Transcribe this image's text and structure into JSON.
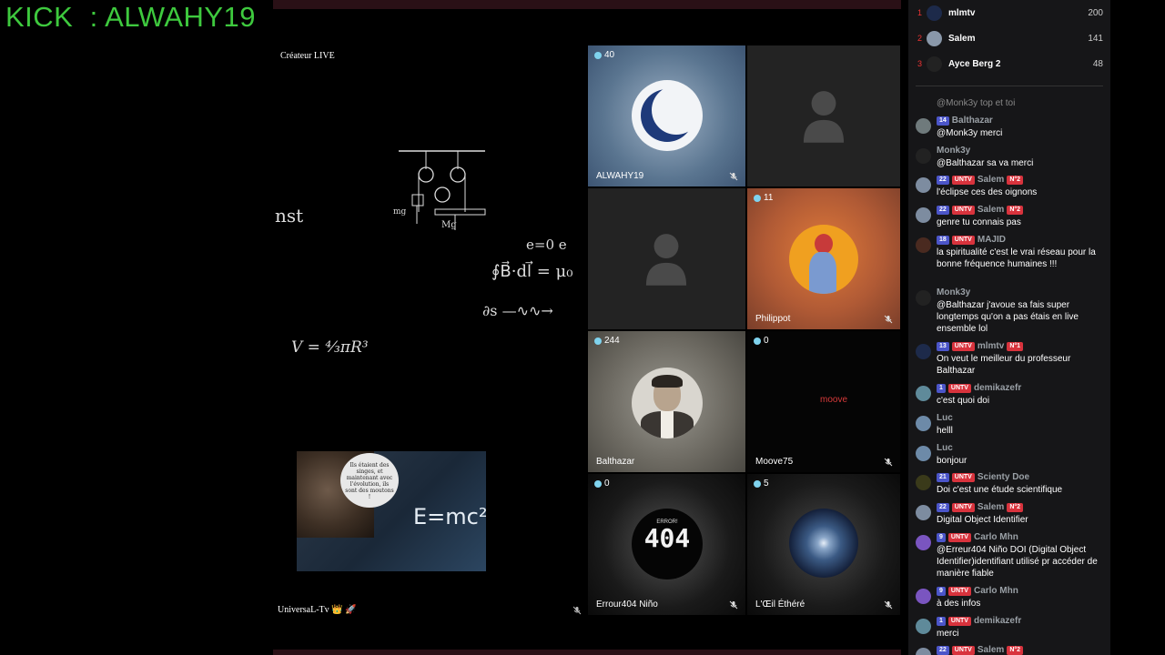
{
  "overlay": {
    "kick_text": "KICK  : ALWAHY19"
  },
  "host": {
    "label": "Créateur LIVE",
    "name": "UniversaL-Tv 👑 🚀"
  },
  "board": {
    "line1": "nst",
    "formula_loop": "∮B⃗·dl⃗ = μ₀",
    "formula_e": "e=0   e",
    "formula_ds": "∂s  —∿∿→",
    "formula_v": "V = ⁴⁄₃πR³",
    "bubble": "Ils étaient des singes, et maintenant avec l'évolution, ils sont des moutons !",
    "emc": "E=mc²",
    "mg1": "Mg",
    "mg2": "mg"
  },
  "tiles": [
    {
      "id": "alwahy",
      "count": "40",
      "name": "ALWAHY19"
    },
    {
      "id": "empty1"
    },
    {
      "id": "empty2"
    },
    {
      "id": "philippot",
      "count": "11",
      "name": "Philippot"
    },
    {
      "id": "balthazar",
      "count": "244",
      "name": "Balthazar"
    },
    {
      "id": "moove",
      "count": "0",
      "name": "Moove75",
      "logo": "moove"
    },
    {
      "id": "errour",
      "count": "0",
      "name": "Errour404 Niño",
      "logo_top": "ERROR!",
      "logo": "404"
    },
    {
      "id": "oeil",
      "count": "5",
      "name": "L'Œil Éthéré"
    }
  ],
  "leaderboard": [
    {
      "rank": "1",
      "name": "mlmtv",
      "score": "200"
    },
    {
      "rank": "2",
      "name": "Salem",
      "score": "141"
    },
    {
      "rank": "3",
      "name": "Ayce Berg 2",
      "score": "48"
    }
  ],
  "messages": [
    {
      "user": "",
      "text": "@Monk3y top et toi"
    },
    {
      "user": "Balthazar",
      "lvl": "14",
      "text": "@Monk3y merci"
    },
    {
      "user": "Monk3y",
      "text": "@Balthazar sa va merci"
    },
    {
      "user": "Salem",
      "lvl": "22",
      "untv": "UNTV",
      "rank": "N°2",
      "text": "l'éclipse ces des oignons"
    },
    {
      "user": "Salem",
      "lvl": "22",
      "untv": "UNTV",
      "rank": "N°2",
      "text": "genre tu connais pas"
    },
    {
      "user": "MAJID",
      "lvl": "18",
      "untv": "UNTV",
      "text": "la spiritualité c'est le vrai réseau pour la bonne fréquence humaines !!!"
    },
    {
      "user": "Monk3y",
      "text": "@Balthazar j'avoue sa fais super longtemps qu'on a pas étais en live ensemble lol"
    },
    {
      "user": "mlmtv",
      "lvl": "13",
      "untv": "UNTV",
      "rank": "N°1",
      "text": "On veut le meilleur du professeur Balthazar"
    },
    {
      "user": "demikazefr",
      "lvl": "1",
      "untv": "UNTV",
      "text": "c'est quoi doi"
    },
    {
      "user": "Luc",
      "text": "helll"
    },
    {
      "user": "Luc",
      "text": "bonjour"
    },
    {
      "user": "Scienty Doe",
      "lvl": "21",
      "untv": "UNTV",
      "text": "Doi c'est une étude scientifique"
    },
    {
      "user": "Salem",
      "lvl": "22",
      "untv": "UNTV",
      "rank": "N°2",
      "text": "Digital Object Identifier"
    },
    {
      "user": "Carlo Mhn",
      "lvl": "9",
      "untv": "UNTV",
      "text": "@Erreur404 Niño DOI (Digital Object Identifier)identifiant utilisé pr accéder de manière fiable"
    },
    {
      "user": "Carlo Mhn",
      "lvl": "9",
      "untv": "UNTV",
      "text": "à des infos"
    },
    {
      "user": "demikazefr",
      "lvl": "1",
      "untv": "UNTV",
      "text": "merci"
    },
    {
      "user": "Salem",
      "lvl": "22",
      "untv": "UNTV",
      "rank": "N°2",
      "text": ""
    }
  ],
  "colors": {
    "kick_green": "#3ec93e",
    "untv_red": "#d8333d",
    "level_blue": "#4b55c9",
    "viewer_dot": "#7fd3ee"
  }
}
